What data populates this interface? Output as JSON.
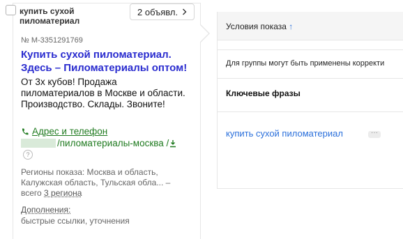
{
  "card": {
    "phrase": "купить сухой пиломатериал",
    "ads_button": "2 объявл.",
    "ad_number": "№ М-3351291769",
    "ad_title": "Купить сухой пиломатериал. Здесь – Пиломатериалы оптом!",
    "ad_text": "От 3х кубов! Продажа пиломатериалов в Москве и области. Производство. Склады. Звоните!",
    "contacts_label": "Адрес и телефон",
    "display_url": "/пиломатериалы-москва /",
    "help_glyph": "?",
    "regions_prefix": "Регионы показа: Москва и область, Калужская область, Тульская обла... – всего",
    "regions_link": "3 региона",
    "extras_label": "Дополнения:",
    "extras_value": "быстрые ссылки, уточнения",
    "accent_color": "#2a2ccf",
    "url_color": "#1f7a1f",
    "icons": [
      "checkbox",
      "chevron-right-icon",
      "phone-icon",
      "download-icon",
      "help-icon"
    ]
  },
  "table": {
    "conditions_header": "Условия показа",
    "sort_glyph": "↑",
    "group_note": "Для группы могут быть применены корректи",
    "phrases_heading": "Ключевые фразы",
    "phrase_link": "купить сухой пиломатериал",
    "more_glyph": "···",
    "link_color": "#2a6fdb"
  }
}
